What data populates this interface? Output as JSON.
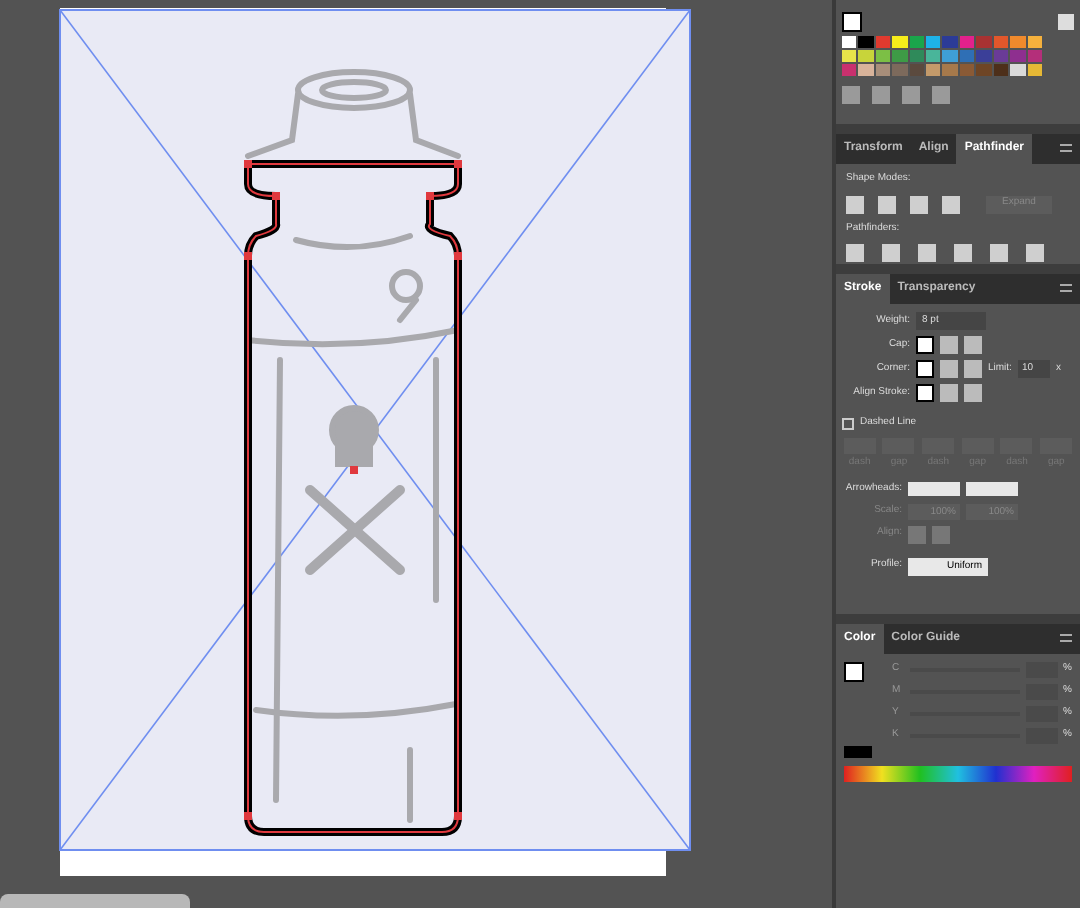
{
  "swatches": {
    "colors": [
      {
        "color": "#ffffff"
      },
      {
        "color": "#000000"
      },
      {
        "color": "#e03a2f"
      },
      {
        "color": "#f6ec1a"
      },
      {
        "color": "#1aa54b"
      },
      {
        "color": "#1eb2e8"
      },
      {
        "color": "#2c3b97"
      },
      {
        "color": "#e3218c"
      },
      {
        "color": "#a83232"
      },
      {
        "color": "#e2572b"
      },
      {
        "color": "#f08a2c"
      },
      {
        "color": "#f5b13d"
      },
      {
        "color": "#e8e44a"
      },
      {
        "color": "#c8d43a"
      },
      {
        "color": "#7cbf45"
      },
      {
        "color": "#3e9b46"
      },
      {
        "color": "#2f8a5a"
      },
      {
        "color": "#49b59a"
      },
      {
        "color": "#3f9fd6"
      },
      {
        "color": "#2f6fb5"
      },
      {
        "color": "#3b3f98"
      },
      {
        "color": "#6a3b97"
      },
      {
        "color": "#8e2f8f"
      },
      {
        "color": "#b42f7a"
      },
      {
        "color": "#c9306e"
      },
      {
        "color": "#d8b39a"
      },
      {
        "color": "#a88e7a"
      },
      {
        "color": "#7d6a5c"
      },
      {
        "color": "#5b4a3e"
      },
      {
        "color": "#c49a6a"
      },
      {
        "color": "#a6794b"
      },
      {
        "color": "#8a5a35"
      },
      {
        "color": "#6e4525"
      },
      {
        "color": "#4d2f1a"
      },
      {
        "color": "#d9d9d9"
      },
      {
        "color": "#e6b835"
      }
    ]
  },
  "pathfinder": {
    "tabs": [
      {
        "label": "Transform",
        "selected": false
      },
      {
        "label": "Align",
        "selected": false
      },
      {
        "label": "Pathfinder",
        "selected": true
      }
    ],
    "shape_modes_label": "Shape Modes:",
    "expand_button": {
      "label": "Expand",
      "disabled": true
    },
    "pathfinders_label": "Pathfinders:"
  },
  "stroke": {
    "tabs": [
      {
        "label": "Stroke",
        "selected": true
      },
      {
        "label": "Transparency",
        "selected": false
      }
    ],
    "weight_label": "Weight:",
    "weight": "8 pt",
    "cap_label": "Cap:",
    "corner_label": "Corner:",
    "limit_label": "Limit:",
    "limit": "10",
    "limit_unit": "x",
    "align_stroke_label": "Align Stroke:",
    "dashed_line": {
      "label": "Dashed Line",
      "checked": false
    },
    "dash_fields": [
      "dash",
      "gap",
      "dash",
      "gap",
      "dash",
      "gap"
    ],
    "arrowheads_label": "Arrowheads:",
    "scale_label": "Scale:",
    "scale_start": "100%",
    "scale_end": "100%",
    "align_label": "Align:",
    "profile_label": "Profile:",
    "profile": "Uniform"
  },
  "color": {
    "tabs": [
      {
        "label": "Color",
        "selected": true
      },
      {
        "label": "Color Guide",
        "selected": false
      }
    ],
    "channels": [
      {
        "label": "C",
        "unit": "%",
        "level": 0
      },
      {
        "label": "M",
        "unit": "%",
        "level": 0
      },
      {
        "label": "Y",
        "unit": "%",
        "level": 0
      },
      {
        "label": "K",
        "unit": "%",
        "level": 0
      }
    ]
  }
}
